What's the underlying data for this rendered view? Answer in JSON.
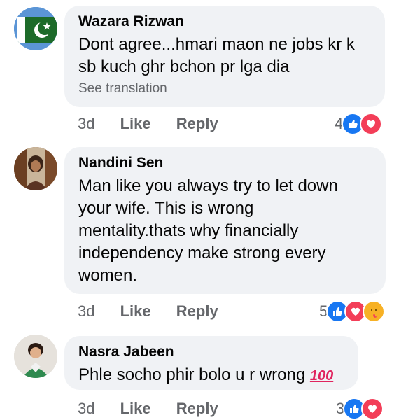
{
  "comments": [
    {
      "author": "Wazara Rizwan",
      "text_lines": [
        "Dont agree...hmari maon ne jobs kr k",
        "sb kuch ghr bchon pr lga dia"
      ],
      "see_translation": "See translation",
      "time": "3d",
      "like_label": "Like",
      "reply_label": "Reply",
      "reaction_count": "4",
      "reactions": [
        "like-icon",
        "love-icon"
      ]
    },
    {
      "author": "Nandini Sen",
      "text_lines": [
        "Man like you always try to let down",
        "your wife. This is wrong",
        "mentality.thats why  financially",
        "independency make strong every",
        "women."
      ],
      "time": "3d",
      "like_label": "Like",
      "reply_label": "Reply",
      "reaction_count": "5",
      "reactions": [
        "like-icon",
        "love-icon",
        "care-icon"
      ]
    },
    {
      "author": "Nasra Jabeen",
      "text": "Phle socho phir bolo  u r wrong",
      "emoji": "100",
      "time": "3d",
      "like_label": "Like",
      "reply_label": "Reply",
      "reaction_count": "3",
      "reactions": [
        "like-icon",
        "love-icon"
      ]
    }
  ],
  "colors": {
    "bubble": "#f0f2f5",
    "like": "#1877f2",
    "love": "#f33e58",
    "care": "#f7b125",
    "meta": "#65676b"
  }
}
